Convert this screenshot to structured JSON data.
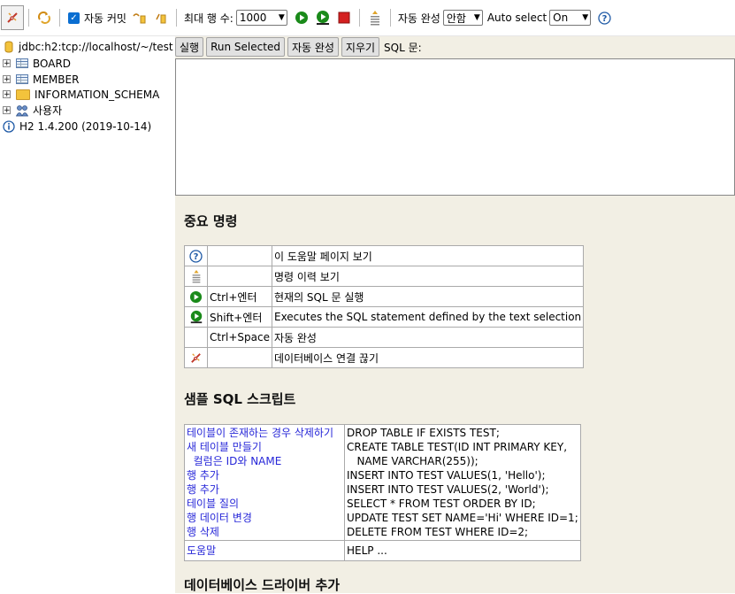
{
  "toolbar": {
    "auto_commit_label": "자동 커밋",
    "max_rows_label": "최대 행 수:",
    "max_rows_value": "1000",
    "autocomplete_label": "자동 완성",
    "autocomplete_value": "안함",
    "auto_select_label": "Auto select",
    "auto_select_value": "On"
  },
  "tree": {
    "connection": "jdbc:h2:tcp://localhost/~/test",
    "items": [
      {
        "label": "BOARD"
      },
      {
        "label": "MEMBER"
      },
      {
        "label": "INFORMATION_SCHEMA"
      },
      {
        "label": "사용자"
      }
    ],
    "version": "H2 1.4.200 (2019-10-14)"
  },
  "buttons": {
    "run": "실행",
    "run_selected": "Run Selected",
    "autocomplete": "자동 완성",
    "clear": "지우기",
    "sql_label": "SQL 문:"
  },
  "help": {
    "title": "중요 명령",
    "rows": [
      {
        "key": "",
        "desc": "이 도움말 페이지 보기"
      },
      {
        "key": "",
        "desc": "명령 이력 보기"
      },
      {
        "key": "Ctrl+엔터",
        "desc": "현재의 SQL 문 실행"
      },
      {
        "key": "Shift+엔터",
        "desc": "Executes the SQL statement defined by the text selection"
      },
      {
        "key": "Ctrl+Space",
        "desc": "자동 완성"
      },
      {
        "key": "",
        "desc": "데이터베이스 연결 끊기"
      }
    ]
  },
  "sample": {
    "title": "샘플 SQL 스크립트",
    "left_lines": [
      "테이블이 존재하는 경우 삭제하기",
      "새 테이블 만들기",
      "  컬럼은 ID와 NAME",
      "행 추가",
      "행 추가",
      "테이블 질의",
      "행 데이터 변경",
      "행 삭제"
    ],
    "right_lines": [
      "DROP TABLE IF EXISTS TEST;",
      "CREATE TABLE TEST(ID INT PRIMARY KEY,",
      "   NAME VARCHAR(255));",
      "INSERT INTO TEST VALUES(1, 'Hello');",
      "INSERT INTO TEST VALUES(2, 'World');",
      "SELECT * FROM TEST ORDER BY ID;",
      "UPDATE TEST SET NAME='Hi' WHERE ID=1;",
      "DELETE FROM TEST WHERE ID=2;"
    ],
    "help_label": "도움말",
    "help_cmd": "HELP ..."
  },
  "driver_title": "데이터베이스 드라이버 추가",
  "colors": {
    "panel_bg": "#f2efe4",
    "link": "#2727d8",
    "run_green": "#1a8a1a",
    "stop_red": "#d42020"
  }
}
